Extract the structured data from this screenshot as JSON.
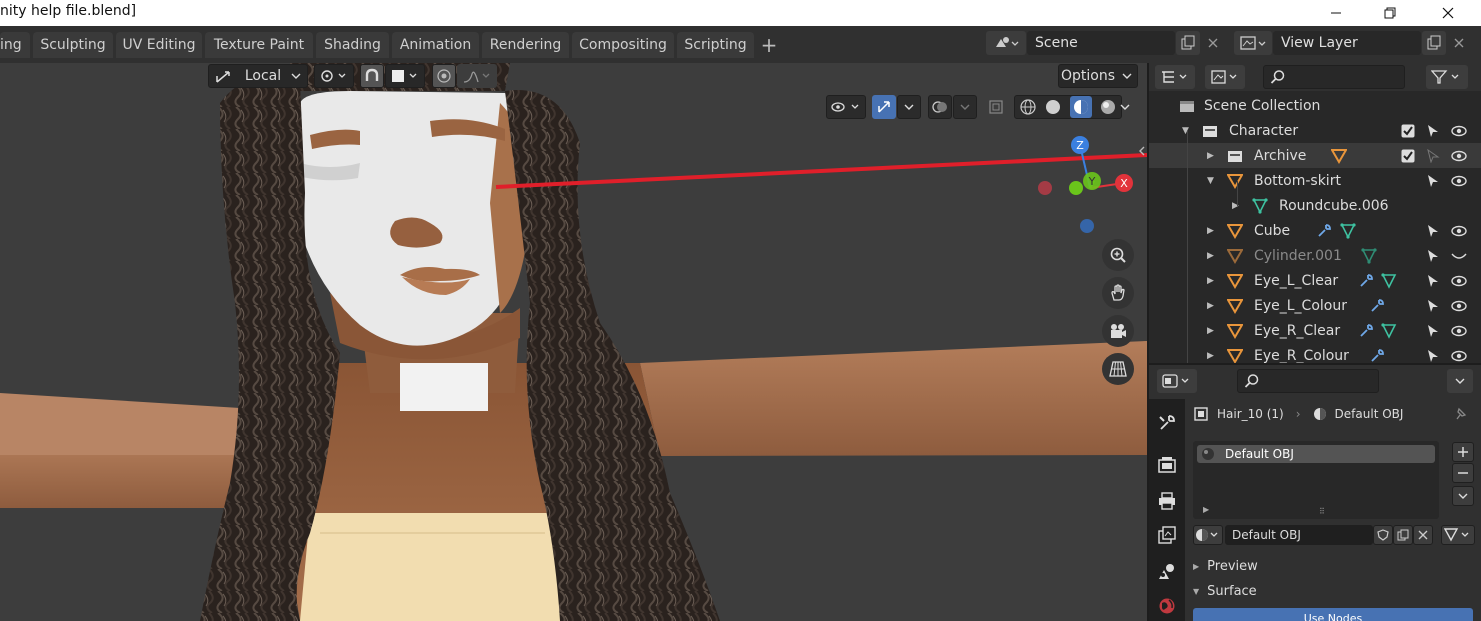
{
  "window": {
    "title": "nity help file.blend]"
  },
  "workspaces": {
    "tabs": [
      "ing",
      "Sculpting",
      "UV Editing",
      "Texture Paint",
      "Shading",
      "Animation",
      "Rendering",
      "Compositing",
      "Scripting"
    ],
    "add_label": "+"
  },
  "scene": {
    "name": "Scene",
    "view_layer": "View Layer"
  },
  "viewport": {
    "orientation": "Local",
    "options_label": "Options",
    "gizmo": {
      "z": "Z",
      "y": "Y",
      "x": "X"
    }
  },
  "outliner": {
    "rows": [
      {
        "label": "Scene Collection",
        "type": "scene-collection"
      },
      {
        "label": "Character",
        "type": "collection"
      },
      {
        "label": "Archive",
        "type": "collection"
      },
      {
        "label": "Bottom-skirt",
        "type": "object"
      },
      {
        "label": "Roundcube.006",
        "type": "mesh"
      },
      {
        "label": "Cube",
        "type": "object"
      },
      {
        "label": "Cylinder.001",
        "type": "object"
      },
      {
        "label": "Eye_L_Clear",
        "type": "object"
      },
      {
        "label": "Eye_L_Colour",
        "type": "object"
      },
      {
        "label": "Eye_R_Clear",
        "type": "object"
      },
      {
        "label": "Eye_R_Colour",
        "type": "object"
      }
    ]
  },
  "properties": {
    "breadcrumb_object": "Hair_10 (1)",
    "breadcrumb_material": "Default OBJ",
    "slot_item": "Default OBJ",
    "material_field": "Default OBJ",
    "preview_label": "Preview",
    "surface_label": "Surface",
    "use_nodes_label": "Use Nodes"
  },
  "colors": {
    "accent_blue": "#4772b3",
    "object_orange": "#e8953b",
    "mesh_green": "#3ec2a1",
    "modifier_blue": "#6fa8e8",
    "annotation_red": "#e01f2a",
    "axis_x": "#e2333b",
    "axis_y": "#6ac51b",
    "axis_z": "#3b80e0"
  }
}
